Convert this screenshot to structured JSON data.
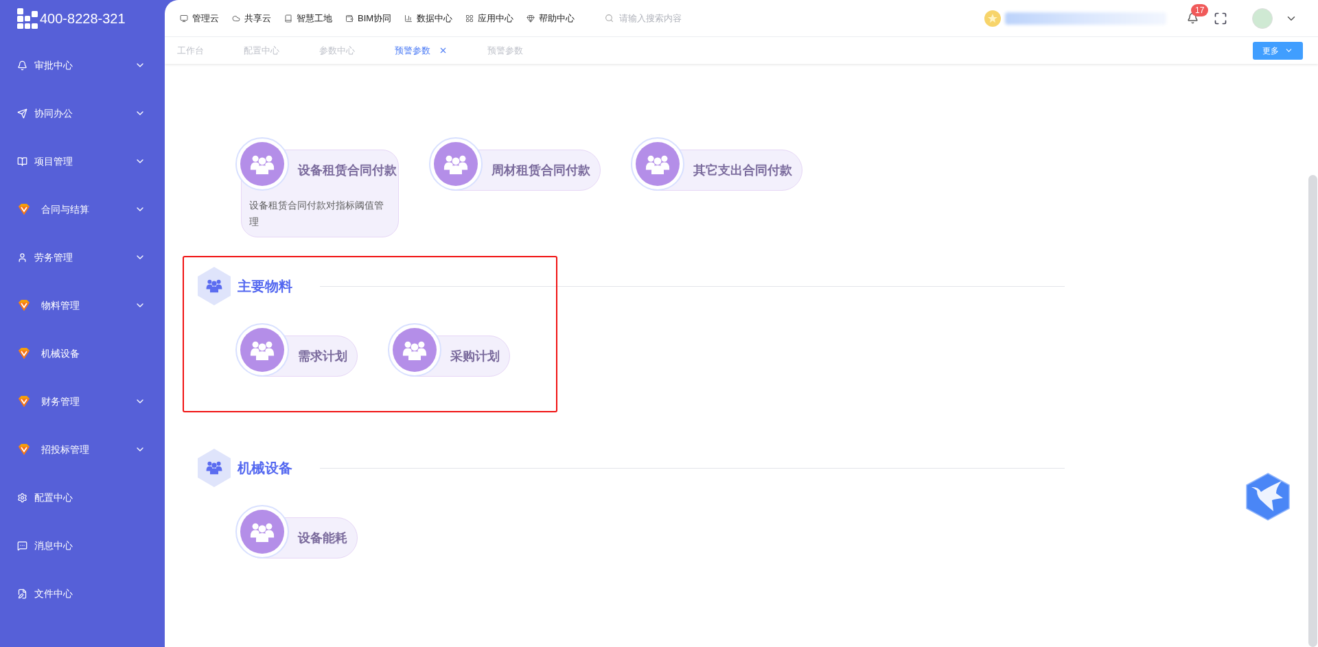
{
  "brand": {
    "phone": "400-8228-321"
  },
  "sidebar": {
    "items": [
      {
        "label": "审批中心",
        "has_submenu": true
      },
      {
        "label": "协同办公",
        "has_submenu": true
      },
      {
        "label": "项目管理",
        "has_submenu": true
      },
      {
        "label": "合同与结算",
        "has_submenu": true
      },
      {
        "label": "劳务管理",
        "has_submenu": true
      },
      {
        "label": "物料管理",
        "has_submenu": true
      },
      {
        "label": "机械设备",
        "has_submenu": false
      },
      {
        "label": "财务管理",
        "has_submenu": true
      },
      {
        "label": "招投标管理",
        "has_submenu": true
      },
      {
        "label": "配置中心",
        "has_submenu": false
      },
      {
        "label": "消息中心",
        "has_submenu": false
      },
      {
        "label": "文件中心",
        "has_submenu": false
      }
    ]
  },
  "top_nav": {
    "items": [
      "管理云",
      "共享云",
      "智慧工地",
      "BIM协同",
      "数据中心",
      "应用中心",
      "帮助中心"
    ],
    "search": {
      "placeholder": "请输入搜索内容"
    },
    "notifications": {
      "count": "17"
    }
  },
  "tabs": [
    {
      "label": "工作台",
      "selected": false,
      "closable": false
    },
    {
      "label": "配置中心",
      "selected": false,
      "closable": false
    },
    {
      "label": "参数中心",
      "selected": false,
      "closable": false
    },
    {
      "label": "预警参数",
      "selected": true,
      "closable": true
    },
    {
      "label": "预警参数",
      "selected": false,
      "closable": false
    }
  ],
  "more_button": "更多",
  "groups": [
    {
      "highlighted": false,
      "cards": [
        {
          "title": "设备租赁合同付款",
          "description": "设备租赁合同付款对指标阈值管理"
        },
        {
          "title": "周材租赁合同付款"
        },
        {
          "title": "其它支出合同付款"
        }
      ]
    },
    {
      "title": "主要物料",
      "highlighted": true,
      "cards": [
        {
          "title": "需求计划"
        },
        {
          "title": "采购计划"
        }
      ]
    },
    {
      "title": "机械设备",
      "highlighted": false,
      "cards": [
        {
          "title": "设备能耗"
        }
      ]
    }
  ]
}
